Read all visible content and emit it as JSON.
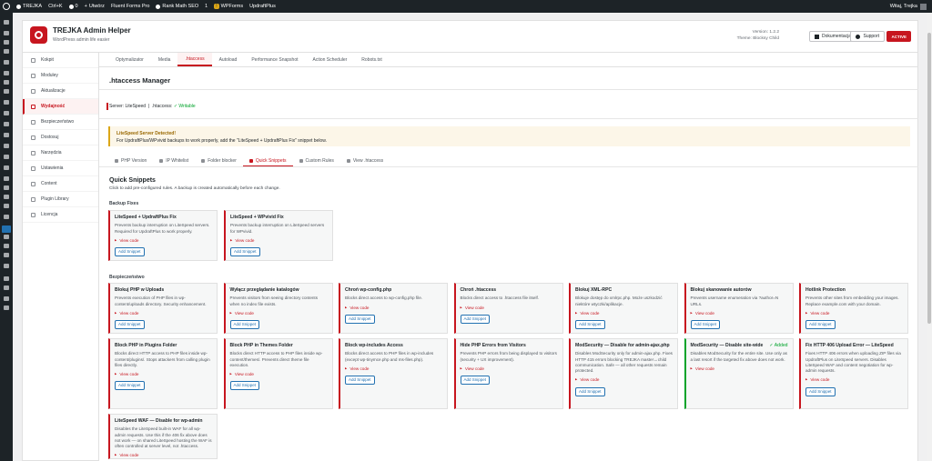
{
  "adminbar": {
    "site": "TREJKA",
    "shortcut": "Ctrl+K",
    "comments": "0",
    "new": "Utwórz",
    "items": [
      "Fluent Forms Pro",
      "Rank Math SEO"
    ],
    "notif": "1",
    "wpforms": "WPForms",
    "updraft": "UpdraftPlus",
    "greeting": "Witaj, Trejka"
  },
  "header": {
    "title": "TREJKA Admin Helper",
    "subtitle": "WordPress admin life easier",
    "version": "Version: 1.2.2",
    "theme": "Theme: Blocksy Child",
    "docs": "Dokumentacja",
    "support": "Support",
    "active": "ACTIVE"
  },
  "sidebar": {
    "items": [
      "Kokpit",
      "Moduley",
      "Aktualizacje",
      "Wydajność",
      "Bezpieczeństwo",
      "Dostosuj",
      "Narzędzia",
      "Ustawienia",
      "Content",
      "Plugin Library",
      "Licencja"
    ]
  },
  "tabs": [
    "Optymalizator",
    "Media",
    ".htaccess",
    "Autoload",
    "Performance Snapshot",
    "Action Scheduler",
    "Robots.txt"
  ],
  "main": {
    "title": ".htaccess Manager",
    "server_label": "Server:",
    "server_value": "LiteSpeed",
    "htaccess_label": ".htaccess:",
    "htaccess_value": "✓ Writable"
  },
  "notice": {
    "title": "LiteSpeed Server Detected!",
    "text": "For UpdraftPlus/WPvivid backups to work properly, add the \"LiteSpeed + UpdraftPlus Fix\" snippet below."
  },
  "subtabs": [
    "PHP Version",
    "IP Whitelist",
    "Folder blocker",
    "Quick Snippets",
    "Custom Rules",
    "View .htaccess"
  ],
  "snippets": {
    "title": "Quick Snippets",
    "desc": "Click to add pre-configured rules. A backup is created automatically before each change."
  },
  "groups": {
    "backup": "Backup Fixes",
    "security": "Bezpieczeństwo"
  },
  "view_code": "View code",
  "add_snippet": "Add Snippet",
  "added": "✓ Added",
  "backup_cards": [
    {
      "title": "LiteSpeed + UpdraftPlus Fix",
      "desc": "Prevents backup interruption on LiteSpeed servers. Required for UpdraftPlus to work properly."
    },
    {
      "title": "LiteSpeed + WPvivid Fix",
      "desc": "Prevents backup interruption on LiteSpeed servers for WPvivid."
    }
  ],
  "security_cards": [
    {
      "title": "Blokuj PHP w Uploads",
      "desc": "Prevents execution of PHP files in wp-content/uploads directory. Security enhancement."
    },
    {
      "title": "Wyłącz przeglądanie katalogów",
      "desc": "Prevents visitors from seeing directory contents when no index file exists."
    },
    {
      "title": "Chroń wp-config.php",
      "desc": "Blocks direct access to wp-config.php file."
    },
    {
      "title": "Chroń .htaccess",
      "desc": "Blocks direct access to .htaccess file itself."
    },
    {
      "title": "Blokuj XML-RPC",
      "desc": "Blokuje dostęp do xmlrpc.php. Może uszkodzić niektóre wtyczki/aplikacje."
    },
    {
      "title": "Blokuj skanowanie autorów",
      "desc": "Prevents username enumeration via ?author=N URLs."
    },
    {
      "title": "Hotlink Protection",
      "desc": "Prevents other sites from embedding your images. Replace example.com with your domain."
    },
    {
      "title": "Block PHP in Plugins Folder",
      "desc": "Blocks direct HTTP access to PHP files inside wp-content/plugins/. Stops attackers from calling plugin files directly."
    },
    {
      "title": "Block PHP in Themes Folder",
      "desc": "Blocks direct HTTP access to PHP files inside wp-content/themes/. Prevents direct theme file execution."
    },
    {
      "title": "Block wp-includes Access",
      "desc": "Blocks direct access to PHP files in wp-includes (except wp-tinymce.php and ms-files.php)."
    },
    {
      "title": "Hide PHP Errors from Visitors",
      "desc": "Prevents PHP errors from being displayed to visitors (security + UX improvement)."
    },
    {
      "title": "ModSecurity — Disable for admin-ajax.php",
      "desc": "Disables ModSecurity only for admin-ajax.php. Fixes HTTP 415 errors blocking TREJKA master↔child communication. Safe — all other requests remain protected."
    },
    {
      "title": "ModSecurity — Disable site-wide",
      "desc": "Disables ModSecurity for the entire site. Use only as a last resort if the targeted fix above does not work.",
      "added": true
    },
    {
      "title": "Fix HTTP 406 Upload Error — LiteSpeed",
      "desc": "Fixes HTTP 406 errors when uploading ZIP files via UpdraftPlus on LiteSpeed servers. Disables LiteSpeed WAF and content negotiation for wp-admin requests."
    },
    {
      "title": "LiteSpeed WAF — Disable for wp-admin",
      "desc": "Disables the LiteSpeed built-in WAF for all wp-admin requests. Use this if the 406 fix above does not work — on shared LiteSpeed hosting the WAF is often controlled at server level, not .htaccess."
    }
  ]
}
